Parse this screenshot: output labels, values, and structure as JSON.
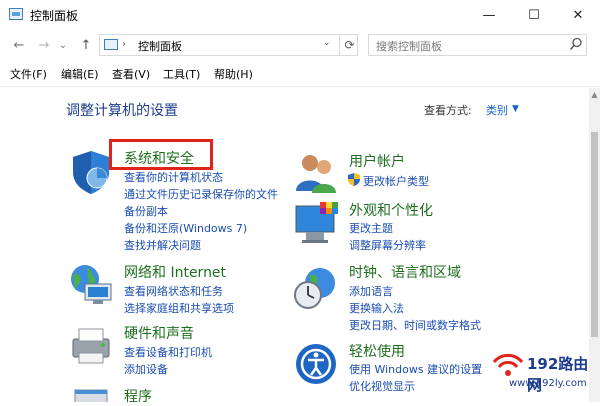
{
  "window": {
    "title": "控制面板",
    "minimize": "—",
    "maximize": "☐",
    "close": "✕"
  },
  "nav": {
    "back": "←",
    "forward": "→",
    "dropdown": "⌄",
    "up": "↑",
    "sep": "›",
    "address": "控制面板",
    "addr_dropdown": "⌄",
    "refresh": "⟳"
  },
  "search": {
    "placeholder": "搜索控制面板"
  },
  "menu": [
    "文件(F)",
    "编辑(E)",
    "查看(V)",
    "工具(T)",
    "帮助(H)"
  ],
  "header": {
    "title": "调整计算机的设置",
    "view_by_label": "查看方式:",
    "view_by_value": "类别",
    "view_dd": "▼"
  },
  "categories": {
    "system_security": {
      "title": "系统和安全",
      "links": [
        "查看你的计算机状态",
        "通过文件历史记录保存你的文件",
        "备份副本",
        "备份和还原(Windows 7)",
        "查找并解决问题"
      ]
    },
    "network": {
      "title": "网络和 Internet",
      "links": [
        "查看网络状态和任务",
        "选择家庭组和共享选项"
      ]
    },
    "hardware": {
      "title": "硬件和声音",
      "links": [
        "查看设备和打印机",
        "添加设备"
      ]
    },
    "programs": {
      "title": "程序"
    },
    "user_accounts": {
      "title": "用户帐户",
      "links": [
        "更改帐户类型"
      ]
    },
    "appearance": {
      "title": "外观和个性化",
      "links": [
        "更改主题",
        "调整屏幕分辨率"
      ]
    },
    "clock": {
      "title": "时钟、语言和区域",
      "links": [
        "添加语言",
        "更换输入法",
        "更改日期、时间或数字格式"
      ]
    },
    "ease": {
      "title": "轻松使用",
      "links": [
        "使用 Windows 建议的设置",
        "优化视觉显示"
      ]
    }
  },
  "watermark": {
    "main": "192路由网",
    "sub": "www.192ly.com"
  },
  "colors": {
    "title_blue": "#1e3e8c",
    "category_green": "#1e6e1e",
    "link_blue": "#1a4db0",
    "highlight_red": "#e0241b"
  }
}
